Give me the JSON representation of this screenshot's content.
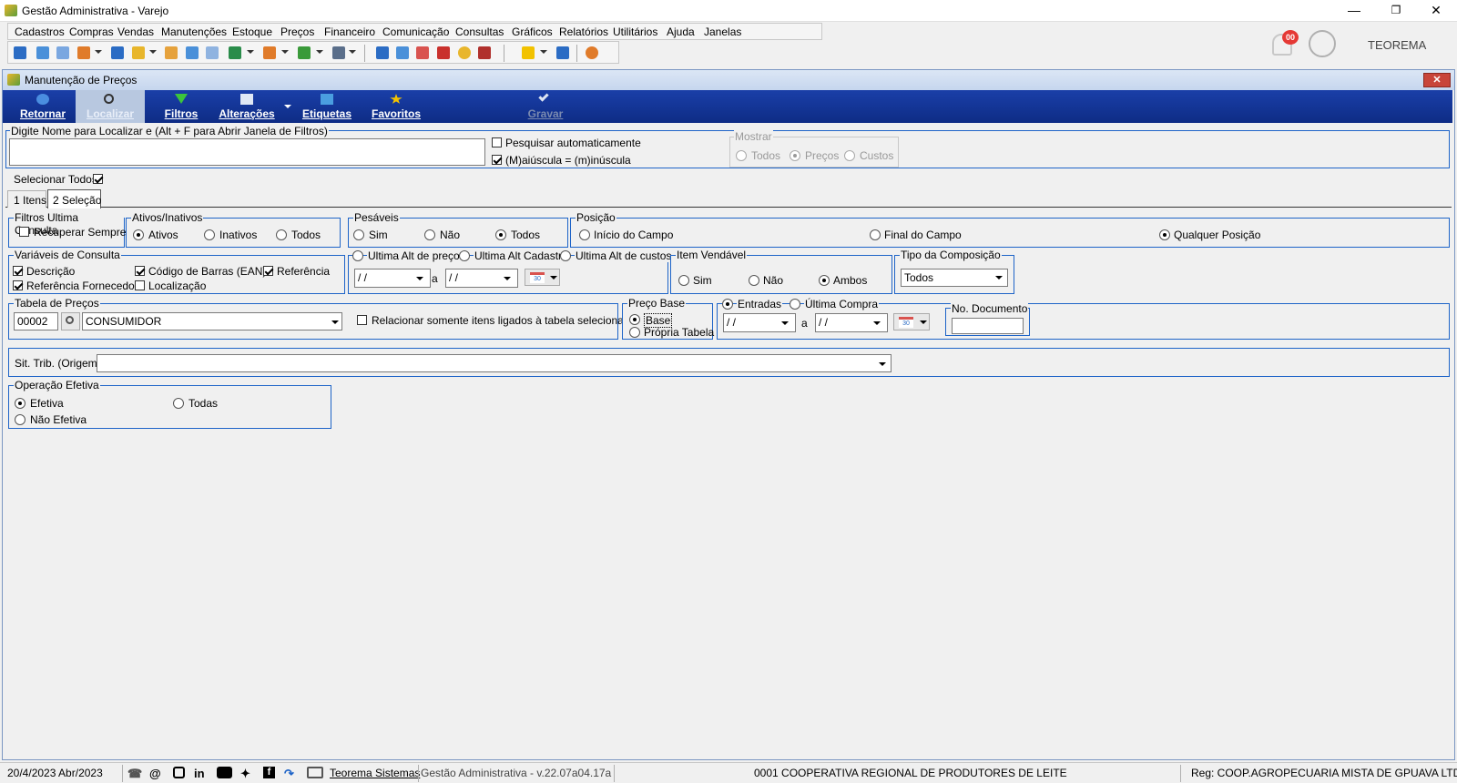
{
  "window": {
    "title": "Gestão Administrativa - Varejo"
  },
  "menu": [
    "Cadastros",
    "Compras",
    "Vendas",
    "Manutenções",
    "Estoque",
    "Preços",
    "Financeiro",
    "Comunicação",
    "Consultas",
    "Gráficos",
    "Relatórios",
    "Utilitários",
    "Ajuda",
    "Janelas"
  ],
  "header_right": {
    "notifications": "00",
    "user": "TEOREMA"
  },
  "child": {
    "title": "Manutenção de Preços"
  },
  "ribbon": {
    "retornar": "Retornar",
    "localizar": "Localizar",
    "filtros": "Filtros",
    "alteracoes": "Alterações",
    "etiquetas": "Etiquetas",
    "favoritos": "Favoritos",
    "gravar": "Gravar"
  },
  "search": {
    "label": "Digite Nome para Localizar e (Alt + F para Abrir Janela de Filtros)",
    "value": "",
    "auto_search": "Pesquisar automaticamente",
    "case_sensitive": "(M)aiúscula = (m)inúscula",
    "show_group": "Mostrar",
    "show_options": [
      "Todos",
      "Preços",
      "Custos"
    ]
  },
  "select_all": "Selecionar Todos",
  "tabs": [
    "1 Itens",
    "2 Seleção"
  ],
  "filters_last": {
    "title": "Filtros Ultima Consulta",
    "recover": "Recuperar Sempre"
  },
  "active": {
    "title": "Ativos/Inativos",
    "options": [
      "Ativos",
      "Inativos",
      "Todos"
    ]
  },
  "weighable": {
    "title": "Pesáveis",
    "options": [
      "Sim",
      "Não",
      "Todos"
    ]
  },
  "position": {
    "title": "Posição",
    "options": [
      "Início do Campo",
      "Final do Campo",
      "Qualquer Posição"
    ]
  },
  "variables": {
    "title": "Variáveis de Consulta",
    "options": [
      "Descrição",
      "Código de Barras (EAN)",
      "Referência",
      "Referência Fornecedor",
      "Localização"
    ]
  },
  "last_alt": {
    "options": [
      "Ultima Alt de preços",
      "Ultima Alt Cadastro",
      "Ultima Alt de custos"
    ],
    "date_from": "/ /",
    "sep": "a",
    "date_to": "/ /",
    "cal": "30"
  },
  "sellable": {
    "title": "Item Vendável",
    "options": [
      "Sim",
      "Não",
      "Ambos"
    ]
  },
  "composition": {
    "title": "Tipo da Composição",
    "value": "Todos"
  },
  "price_table": {
    "title": "Tabela de Preços",
    "code": "00002",
    "name": "CONSUMIDOR",
    "only_linked": "Relacionar somente itens ligados à tabela selecionada"
  },
  "base_price": {
    "title": "Preço Base",
    "options": [
      "Base",
      "Própria Tabela"
    ]
  },
  "entries": {
    "options": [
      "Entradas",
      "Última Compra"
    ],
    "date_from": "/ /",
    "sep": "a",
    "date_to": "/ /",
    "cal": "30",
    "doc_label": "No. Documento",
    "doc_value": ""
  },
  "sit_trib": {
    "label": "Sit. Trib. (Origem)",
    "value": ""
  },
  "operation": {
    "title": "Operação Efetiva",
    "options": [
      "Efetiva",
      "Todas",
      "Não Efetiva"
    ]
  },
  "status": {
    "date": "20/4/2023 Abr/2023",
    "company_link": "Teorema Sistemas",
    "version": "Gestão Administrativa - v.22.07a04.17a",
    "coop": "0001 COOPERATIVA REGIONAL DE PRODUTORES DE LEITE",
    "reg": "Reg: COOP.AGROPECUARIA MISTA DE GPUAVA LTDA"
  }
}
